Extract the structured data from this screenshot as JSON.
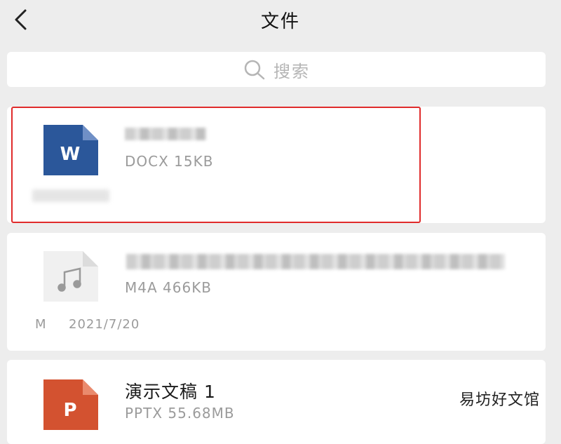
{
  "header": {
    "title": "文件"
  },
  "search": {
    "placeholder": "搜索"
  },
  "files": [
    {
      "type_label": "W",
      "meta": "DOCX 15KB",
      "color": "#2b579a"
    },
    {
      "meta": "M4A 466KB",
      "foot_prefix": "M",
      "date": "2021/7/20",
      "color": "#f2f2f2"
    },
    {
      "name": "演示文稿 1",
      "type_label": "P",
      "meta": "PPTX 55.68MB",
      "color": "#d35230"
    }
  ],
  "watermark": "易坊好文馆",
  "colors": {
    "highlight": "#e02b2b",
    "background": "#ededed"
  }
}
